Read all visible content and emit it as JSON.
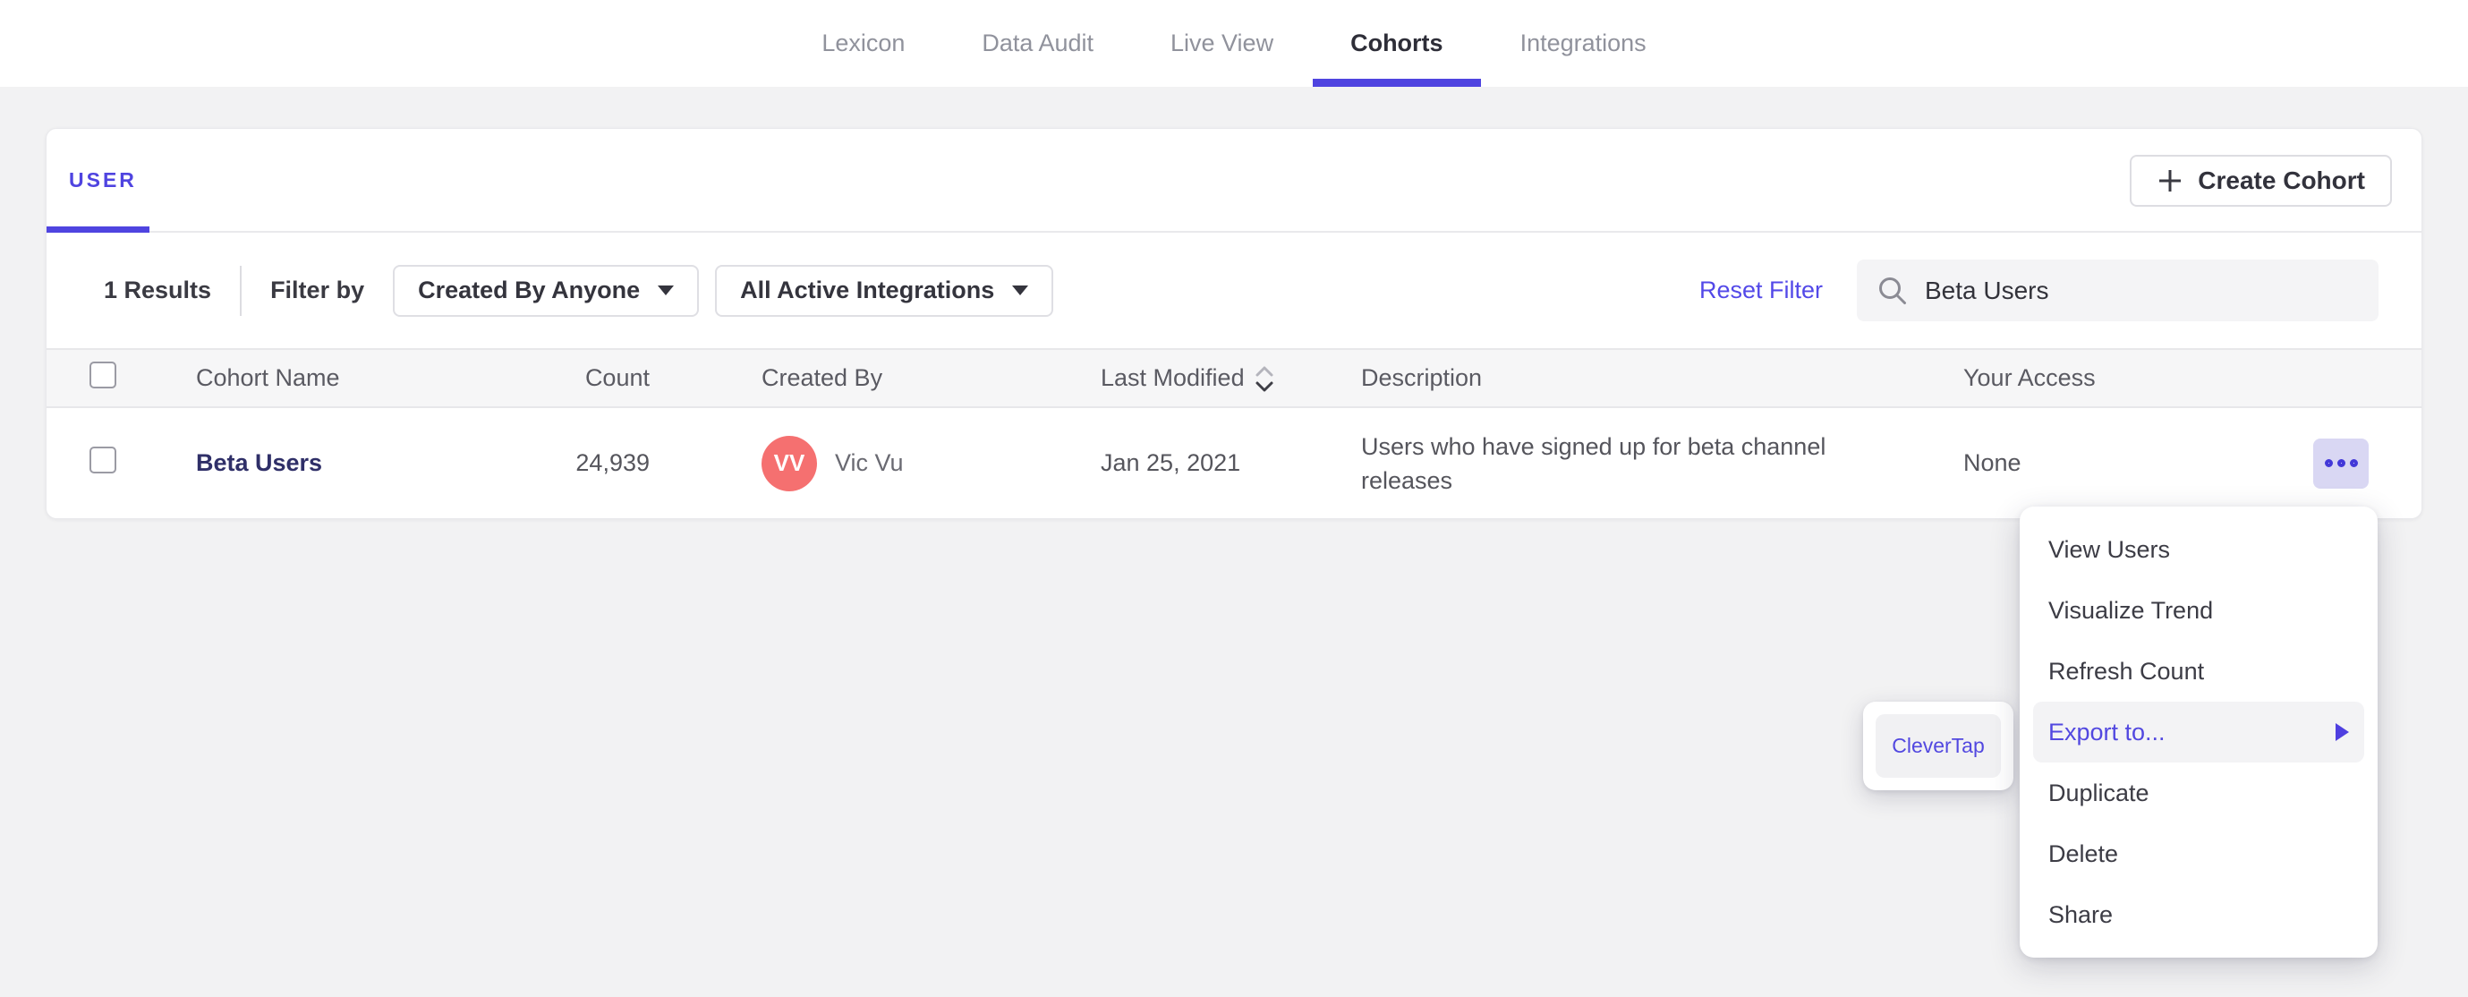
{
  "nav": {
    "tabs": [
      {
        "label": "Lexicon",
        "active": false
      },
      {
        "label": "Data Audit",
        "active": false
      },
      {
        "label": "Live View",
        "active": false
      },
      {
        "label": "Cohorts",
        "active": true
      },
      {
        "label": "Integrations",
        "active": false
      }
    ]
  },
  "cohorts_panel": {
    "tab_label": "USER",
    "create_cohort_label": "Create Cohort",
    "filters": {
      "results": "1 Results",
      "filter_by": "Filter by",
      "created_by_dropdown": "Created By Anyone",
      "integrations_dropdown": "All Active Integrations",
      "reset_filter": "Reset Filter",
      "search_value": "Beta Users"
    },
    "table": {
      "headers": {
        "cohort_name": "Cohort Name",
        "count": "Count",
        "created_by": "Created By",
        "last_modified": "Last Modified",
        "description": "Description",
        "your_access": "Your Access"
      },
      "rows": [
        {
          "cohort_name": "Beta Users",
          "count": "24,939",
          "avatar_initials": "VV",
          "created_by": "Vic Vu",
          "last_modified": "Jan 25, 2021",
          "description": "Users who have signed up for beta channel releases",
          "your_access": "None"
        }
      ]
    }
  },
  "context_menu": {
    "items": [
      {
        "label": "View Users",
        "highlighted": false
      },
      {
        "label": "Visualize Trend",
        "highlighted": false
      },
      {
        "label": "Refresh Count",
        "highlighted": false
      },
      {
        "label": "Export to...",
        "highlighted": true,
        "has_submenu": true
      },
      {
        "label": "Duplicate",
        "highlighted": false
      },
      {
        "label": "Delete",
        "highlighted": false
      },
      {
        "label": "Share",
        "highlighted": false
      }
    ]
  },
  "export_submenu": {
    "items": [
      {
        "label": "CleverTap"
      }
    ]
  },
  "colors": {
    "accent_purple": "#4f44e0",
    "link_purple": "#5349e8",
    "cohort_link_navy": "#2f2f68",
    "avatar_coral": "#f57070",
    "actions_button_bg": "#d9d7f3",
    "page_background": "#f2f2f3",
    "header_row_background": "#f6f6f7"
  }
}
